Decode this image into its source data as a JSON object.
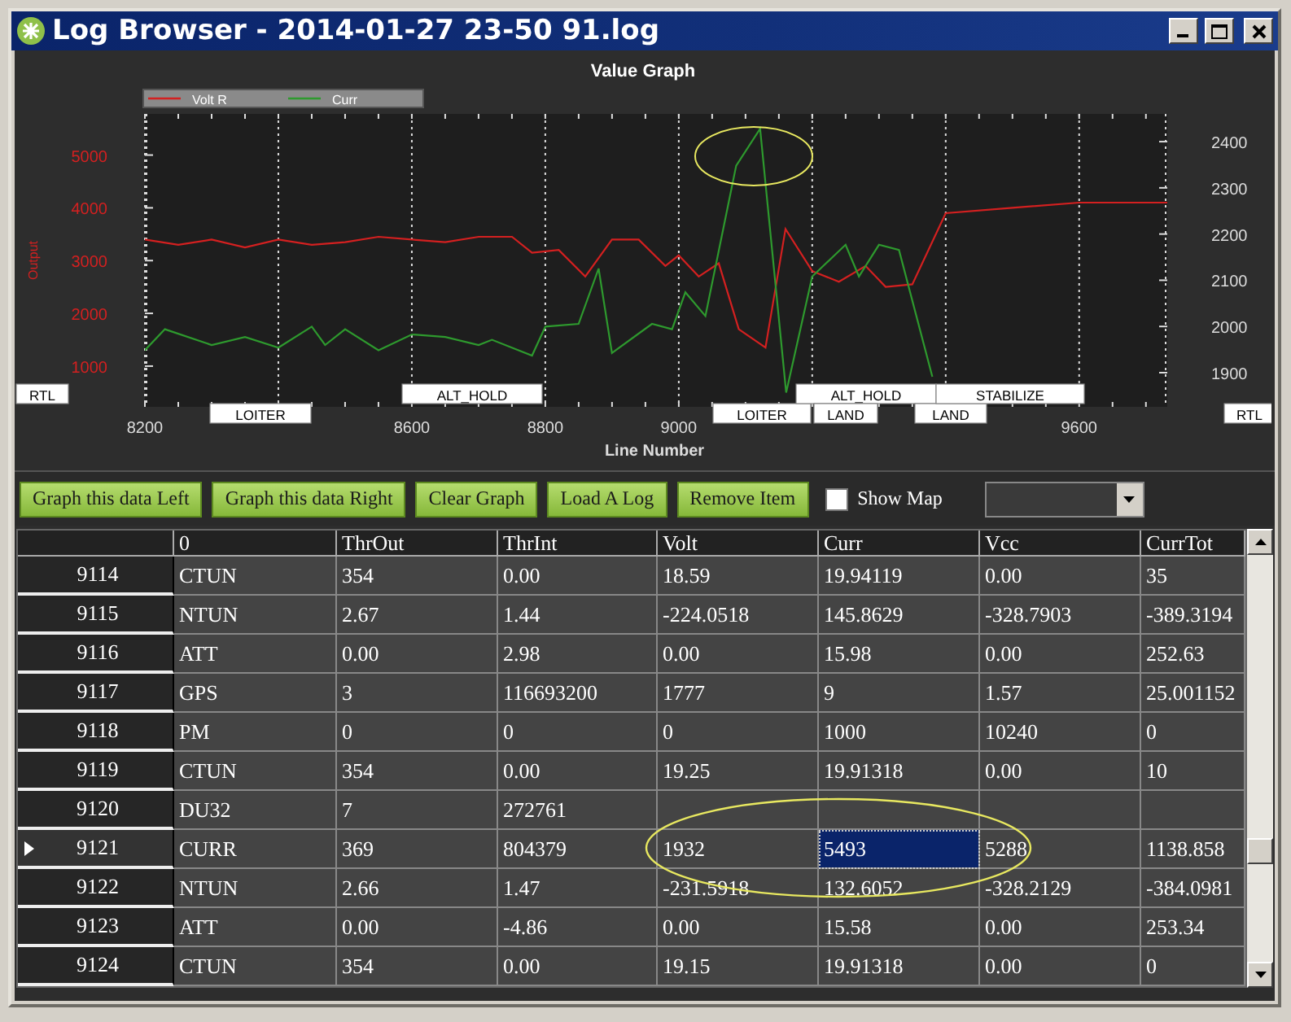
{
  "window": {
    "title": "Log Browser - 2014-01-27 23-50 91.log"
  },
  "graph": {
    "chart_data": {
      "type": "line",
      "title": "Value Graph",
      "xlabel": "Line Number",
      "ylabel": "Output",
      "xlim": [
        8200,
        9732
      ],
      "ylim": [
        228,
        5780
      ],
      "xticks": [
        8200,
        8600,
        8800,
        9000,
        9600
      ],
      "yticks": [
        1000,
        2000,
        3000,
        4000,
        5000
      ],
      "y2lim": [
        1826,
        2460
      ],
      "y2ticks": [
        1900,
        2000,
        2100,
        2200,
        2300,
        2400
      ],
      "series": [
        {
          "name": "Volt R",
          "color": "#d42020",
          "x": [
            8200,
            8250,
            8300,
            8350,
            8400,
            8450,
            8500,
            8550,
            8600,
            8650,
            8700,
            8750,
            8780,
            8820,
            8860,
            8900,
            8940,
            8980,
            9000,
            9030,
            9060,
            9090,
            9130,
            9160,
            9200,
            9240,
            9280,
            9310,
            9350,
            9400,
            9500,
            9600,
            9732
          ],
          "values": [
            3400,
            3300,
            3400,
            3250,
            3400,
            3300,
            3350,
            3450,
            3400,
            3350,
            3450,
            3450,
            3150,
            3200,
            2700,
            3400,
            3400,
            2900,
            3100,
            2700,
            2950,
            1700,
            1350,
            3600,
            2800,
            2600,
            2900,
            2500,
            2550,
            3900,
            4000,
            4100,
            4100
          ]
        },
        {
          "name": "Curr",
          "color": "#2e9a2e",
          "x": [
            8200,
            8230,
            8300,
            8350,
            8400,
            8450,
            8470,
            8500,
            8550,
            8600,
            8650,
            8700,
            8720,
            8780,
            8800,
            8850,
            8880,
            8900,
            8960,
            8990,
            9010,
            9040,
            9086,
            9122,
            9161,
            9200,
            9250,
            9270,
            9300,
            9330,
            9380
          ],
          "values": [
            1300,
            1700,
            1400,
            1550,
            1350,
            1750,
            1400,
            1700,
            1300,
            1600,
            1550,
            1400,
            1500,
            1200,
            1750,
            1800,
            2850,
            1250,
            1800,
            1700,
            2400,
            1950,
            4800,
            5500,
            500,
            2700,
            3300,
            2700,
            3300,
            3200,
            800
          ]
        }
      ],
      "grid": true,
      "legend": true,
      "annotations": [
        "RTL",
        "LOITER",
        "ALT_HOLD",
        "LOITER",
        "ALT_HOLD",
        "LAND",
        "LAND",
        "STABILIZE",
        "RTL"
      ]
    }
  },
  "toolbar": {
    "buttons": [
      "Graph this data Left",
      "Graph this data Right",
      "Clear Graph",
      "Load A Log",
      "Remove Item"
    ],
    "show_map": {
      "label": "Show Map",
      "checked": false
    }
  },
  "table": {
    "columns": [
      "0",
      "ThrOut",
      "ThrInt",
      "Volt",
      "Curr",
      "Vcc",
      "CurrTot"
    ],
    "rows": [
      {
        "header": "9114",
        "current": false,
        "cells": [
          {
            "text": "CTUN",
            "selected": false
          },
          {
            "text": "354",
            "selected": false
          },
          {
            "text": "0.00",
            "selected": false
          },
          {
            "text": "18.59",
            "selected": false
          },
          {
            "text": "19.94119",
            "selected": false
          },
          {
            "text": "0.00",
            "selected": false
          },
          {
            "text": "35",
            "selected": false
          }
        ]
      },
      {
        "header": "9115",
        "current": false,
        "cells": [
          {
            "text": "NTUN",
            "selected": false
          },
          {
            "text": "2.67",
            "selected": false
          },
          {
            "text": "1.44",
            "selected": false
          },
          {
            "text": "-224.0518",
            "selected": false
          },
          {
            "text": "145.8629",
            "selected": false
          },
          {
            "text": "-328.7903",
            "selected": false
          },
          {
            "text": "-389.3194",
            "selected": false
          }
        ]
      },
      {
        "header": "9116",
        "current": false,
        "cells": [
          {
            "text": "ATT",
            "selected": false
          },
          {
            "text": "0.00",
            "selected": false
          },
          {
            "text": "2.98",
            "selected": false
          },
          {
            "text": "0.00",
            "selected": false
          },
          {
            "text": "15.98",
            "selected": false
          },
          {
            "text": "0.00",
            "selected": false
          },
          {
            "text": "252.63",
            "selected": false
          }
        ]
      },
      {
        "header": "9117",
        "current": false,
        "cells": [
          {
            "text": "GPS",
            "selected": false
          },
          {
            "text": "3",
            "selected": false
          },
          {
            "text": "116693200",
            "selected": false
          },
          {
            "text": "1777",
            "selected": false
          },
          {
            "text": "9",
            "selected": false
          },
          {
            "text": "1.57",
            "selected": false
          },
          {
            "text": "25.001152",
            "selected": false
          }
        ]
      },
      {
        "header": "9118",
        "current": false,
        "cells": [
          {
            "text": "PM",
            "selected": false
          },
          {
            "text": "0",
            "selected": false
          },
          {
            "text": "0",
            "selected": false
          },
          {
            "text": "0",
            "selected": false
          },
          {
            "text": "1000",
            "selected": false
          },
          {
            "text": "10240",
            "selected": false
          },
          {
            "text": "0",
            "selected": false
          }
        ]
      },
      {
        "header": "9119",
        "current": false,
        "cells": [
          {
            "text": "CTUN",
            "selected": false
          },
          {
            "text": "354",
            "selected": false
          },
          {
            "text": "0.00",
            "selected": false
          },
          {
            "text": "19.25",
            "selected": false
          },
          {
            "text": "19.91318",
            "selected": false
          },
          {
            "text": "0.00",
            "selected": false
          },
          {
            "text": "10",
            "selected": false
          }
        ]
      },
      {
        "header": "9120",
        "current": false,
        "cells": [
          {
            "text": "DU32",
            "selected": false
          },
          {
            "text": "7",
            "selected": false
          },
          {
            "text": "272761",
            "selected": false
          },
          {
            "selected": false
          },
          {
            "selected": false
          },
          {
            "selected": false
          },
          {
            "selected": false
          }
        ]
      },
      {
        "header": "9121",
        "current": true,
        "cells": [
          {
            "text": "CURR",
            "selected": false
          },
          {
            "text": "369",
            "selected": false
          },
          {
            "text": "804379",
            "selected": false
          },
          {
            "text": "1932",
            "selected": false
          },
          {
            "text": "5493",
            "selected": true
          },
          {
            "text": "5288",
            "selected": false
          },
          {
            "text": "1138.858",
            "selected": false
          }
        ]
      },
      {
        "header": "9122",
        "current": false,
        "cells": [
          {
            "text": "NTUN",
            "selected": false
          },
          {
            "text": "2.66",
            "selected": false
          },
          {
            "text": "1.47",
            "selected": false
          },
          {
            "text": "-231.5918",
            "selected": false
          },
          {
            "text": "132.6052",
            "selected": false
          },
          {
            "text": "-328.2129",
            "selected": false
          },
          {
            "text": "-384.0981",
            "selected": false
          }
        ]
      },
      {
        "header": "9123",
        "current": false,
        "cells": [
          {
            "text": "ATT",
            "selected": false
          },
          {
            "text": "0.00",
            "selected": false
          },
          {
            "text": "-4.86",
            "selected": false
          },
          {
            "text": "0.00",
            "selected": false
          },
          {
            "text": "15.58",
            "selected": false
          },
          {
            "text": "0.00",
            "selected": false
          },
          {
            "text": "253.34",
            "selected": false
          }
        ]
      },
      {
        "header": "9124",
        "current": false,
        "cells": [
          {
            "text": "CTUN",
            "selected": false
          },
          {
            "text": "354",
            "selected": false
          },
          {
            "text": "0.00",
            "selected": false
          },
          {
            "text": "19.15",
            "selected": false
          },
          {
            "text": "19.91318",
            "selected": false
          },
          {
            "text": "0.00",
            "selected": false
          },
          {
            "text": "0",
            "selected": false
          }
        ]
      }
    ]
  }
}
